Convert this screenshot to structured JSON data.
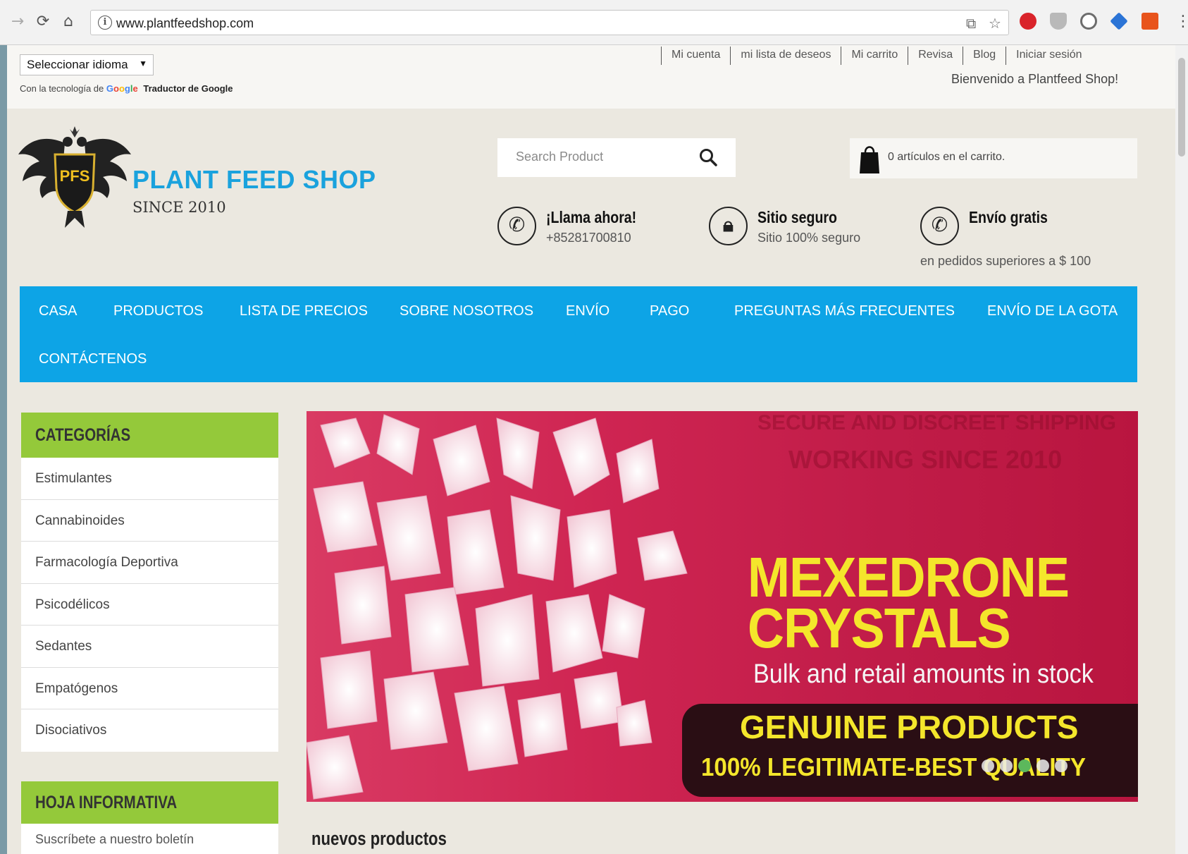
{
  "browser": {
    "url": "www.plantfeedshop.com",
    "back_icon": "back-arrow-icon",
    "reload_icon": "reload-icon",
    "home_icon": "home-icon",
    "info_icon": "i"
  },
  "topbar": {
    "language_select": "Seleccionar idioma",
    "powered_prefix": "Con la tecnología de",
    "google_logo": "Google",
    "translator": "Traductor de Google",
    "account_links": [
      "Mi cuenta",
      "mi lista de deseos",
      "Mi carrito",
      "Revisa",
      "Blog",
      "Iniciar sesión"
    ],
    "welcome": "Bienvenido a Plantfeed Shop!"
  },
  "header": {
    "logo_badge": "PFS",
    "brand_name": "PLANT FEED SHOP",
    "brand_since": "SINCE 2010",
    "search_placeholder": "Search Product",
    "cart_text": "0 artículos en el carrito.",
    "features": [
      {
        "title": "¡Llama ahora!",
        "subtitle": "+85281700810",
        "icon": "phone-icon"
      },
      {
        "title": "Sitio seguro",
        "subtitle": "Sitio 100% seguro",
        "icon": "lock-icon"
      },
      {
        "title": "Envío gratis",
        "subtitle": "en pedidos superiores a $ 100",
        "icon": "phone-icon"
      }
    ]
  },
  "nav": {
    "items": [
      "CASA",
      "PRODUCTOS",
      "LISTA DE PRECIOS",
      "SOBRE NOSOTROS",
      "ENVÍO",
      "PAGO",
      "PREGUNTAS MÁS FRECUENTES",
      "ENVÍO DE LA GOTA",
      "CONTÁCTENOS"
    ]
  },
  "sidebar": {
    "categories_title": "CATEGORÍAS",
    "categories": [
      "Estimulantes",
      "Cannabinoides",
      "Farmacología Deportiva",
      "Psicodélicos",
      "Sedantes",
      "Empatógenos",
      "Disociativos"
    ],
    "newsletter_title": "HOJA INFORMATIVA",
    "newsletter_text": "Suscríbete a nuestro boletín"
  },
  "banner": {
    "ghost_line1": "SECURE AND DISCREET SHIPPING",
    "ghost_line2": "WORKING SINCE 2010",
    "title_line1": "MEXEDRONE",
    "title_line2": "CRYSTALS",
    "tagline": "Bulk and retail amounts in stock",
    "genuine": "GENUINE PRODUCTS",
    "legit": "100% LEGITIMATE-BEST QUALITY",
    "slide_count": 5,
    "active_slide": 2
  },
  "main": {
    "new_products_title": "nuevos productos"
  },
  "colors": {
    "nav_blue": "#0da4e6",
    "brand_blue": "#1aa2dd",
    "category_green": "#94c93a",
    "banner_red": "#c01c48",
    "banner_yellow": "#f4e62b"
  }
}
